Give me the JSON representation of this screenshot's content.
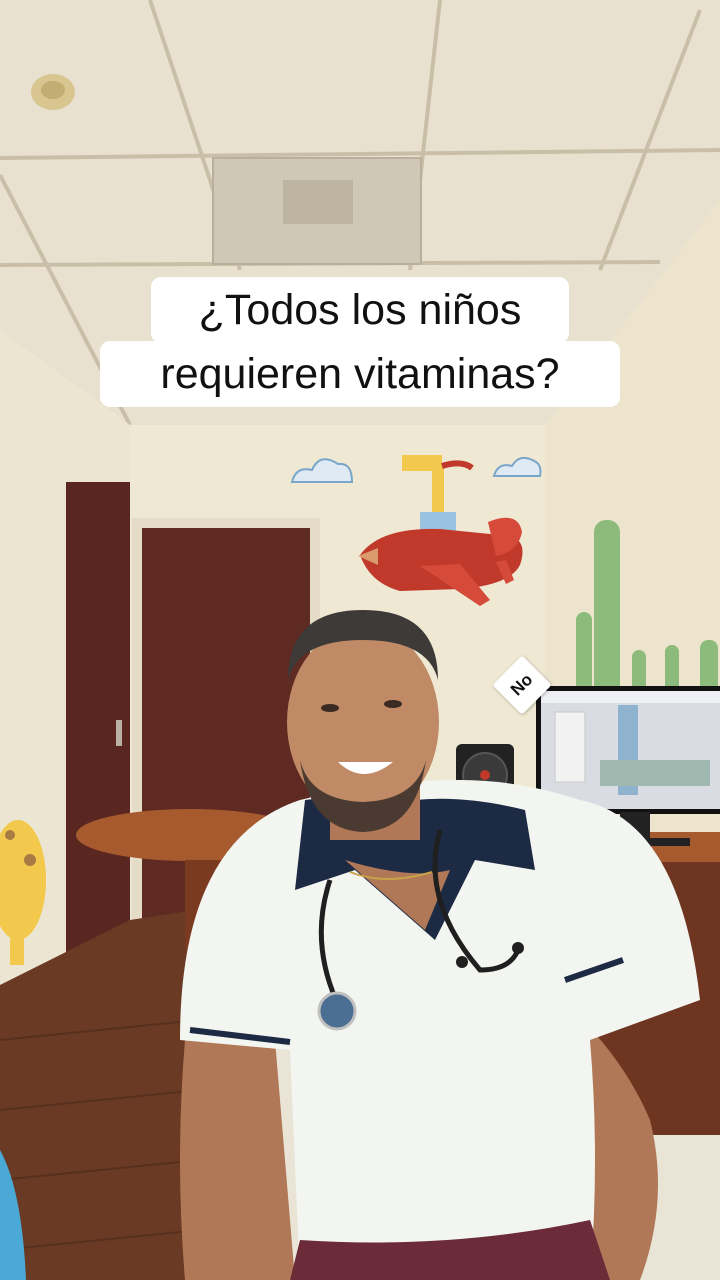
{
  "caption": {
    "line1": "¿Todos los niños",
    "line2": "requieren vitaminas?"
  },
  "sticker": {
    "label": "No"
  },
  "icons": {
    "sticker_shape": "rotated-square-label",
    "smoke_detector": "smoke-detector-icon"
  },
  "colors": {
    "caption_bg": "#ffffff",
    "caption_text": "#111111",
    "wall": "#efe9d7",
    "door": "#5e2a22",
    "airplane": "#c0392b"
  }
}
